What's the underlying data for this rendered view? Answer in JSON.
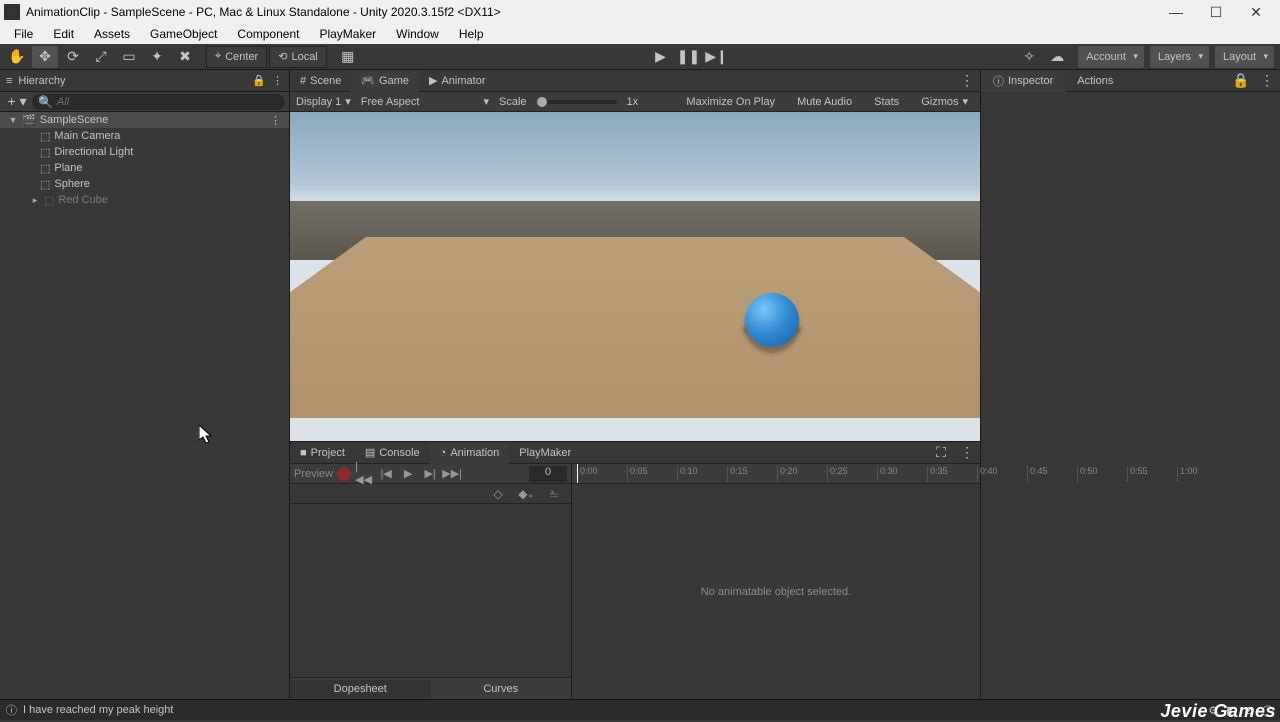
{
  "window": {
    "title": "AnimationClip - SampleScene - PC, Mac & Linux Standalone - Unity 2020.3.15f2 <DX11>"
  },
  "menubar": [
    "File",
    "Edit",
    "Assets",
    "GameObject",
    "Component",
    "PlayMaker",
    "Window",
    "Help"
  ],
  "toolbar": {
    "center": "Center",
    "local": "Local",
    "account": "Account",
    "layers": "Layers",
    "layout": "Layout"
  },
  "hierarchy": {
    "title": "Hierarchy",
    "search_placeholder": "All",
    "scene": "SampleScene",
    "items": [
      "Main Camera",
      "Directional Light",
      "Plane",
      "Sphere",
      "Red Cube"
    ]
  },
  "sceneTabs": {
    "scene": "Scene",
    "game": "Game",
    "animator": "Animator"
  },
  "gamebar": {
    "display": "Display 1",
    "aspect": "Free Aspect",
    "scale_label": "Scale",
    "scale_value": "1x",
    "maximize": "Maximize On Play",
    "mute": "Mute Audio",
    "stats": "Stats",
    "gizmos": "Gizmos"
  },
  "animTabs": {
    "project": "Project",
    "console": "Console",
    "animation": "Animation",
    "playmaker": "PlayMaker"
  },
  "animation": {
    "preview": "Preview",
    "frame": "0",
    "empty": "No animatable object selected.",
    "dopesheet": "Dopesheet",
    "curves": "Curves",
    "ticks": [
      "0:00",
      "0:05",
      "0:10",
      "0:15",
      "0:20",
      "0:25",
      "0:30",
      "0:35",
      "0:40",
      "0:45",
      "0:50",
      "0:55",
      "1:00"
    ]
  },
  "inspector": {
    "inspector": "Inspector",
    "actions": "Actions"
  },
  "status": {
    "message": "I have reached my peak height",
    "brand": "Jevie Games"
  }
}
